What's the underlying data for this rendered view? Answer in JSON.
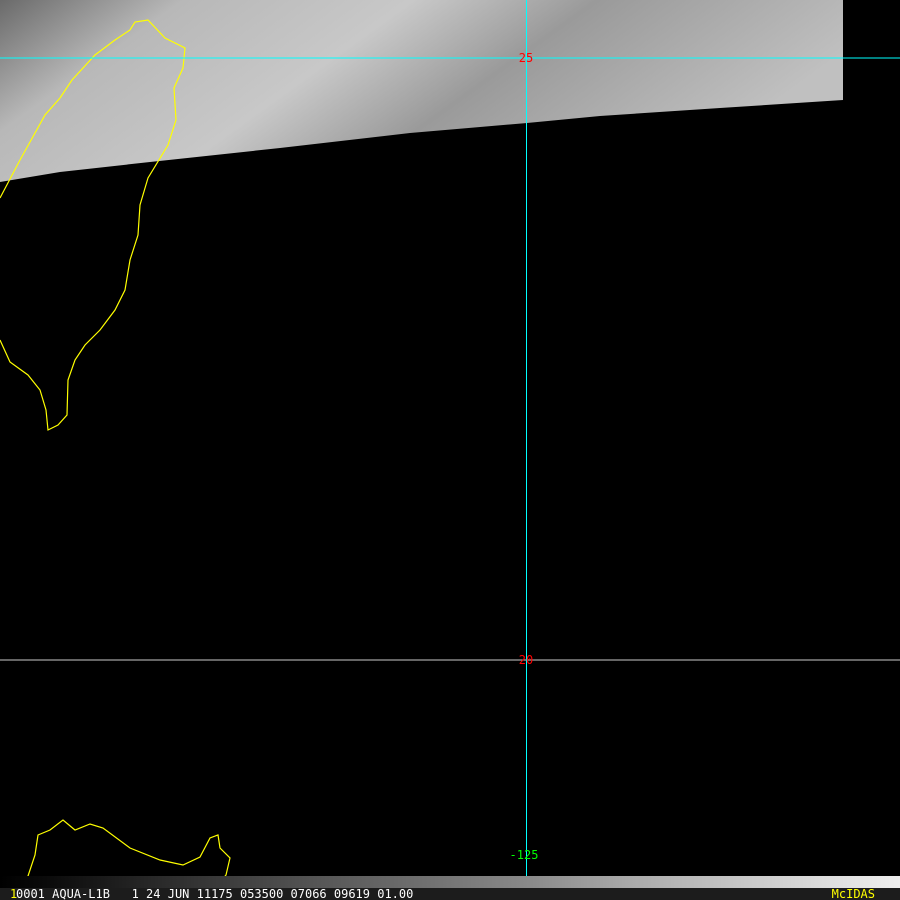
{
  "image": {
    "latitude_labels": [
      "25",
      "20"
    ],
    "longitude_labels": [
      "-125"
    ],
    "colors": {
      "lat_line": "#00ffff",
      "lon_line": "#00ffff",
      "coast": "#ffff00",
      "lat_label": "#ff0000",
      "lon_label": "#00ff00"
    }
  },
  "status_bar": {
    "frame_number": "1",
    "info": "0001 AQUA-L1B   1 24 JUN 11175 053500 07066 09619 01.00",
    "brand": "McIDAS"
  }
}
